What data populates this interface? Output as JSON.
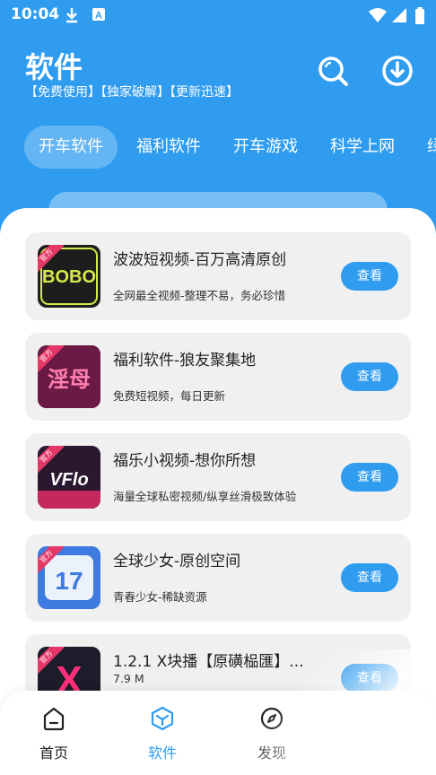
{
  "status_bar": {
    "time": "10:04",
    "icons": [
      "download-icon",
      "a-badge-icon",
      "wifi-icon",
      "signal-icon",
      "battery-icon"
    ]
  },
  "header": {
    "title": "软件",
    "subtitle": "【免费使用】【独家破解】【更新迅速】",
    "actions": [
      "search-icon",
      "download-icon"
    ]
  },
  "tabs": [
    {
      "label": "开车软件",
      "active": true
    },
    {
      "label": "福利软件",
      "active": false
    },
    {
      "label": "开车游戏",
      "active": false
    },
    {
      "label": "科学上网",
      "active": false
    },
    {
      "label": "绿",
      "active": false
    }
  ],
  "apps": [
    {
      "name": "波波短视频-百万高清原创",
      "desc": "全网最全视频-整理不易，务必珍惜",
      "button": "查看",
      "thumb_text": "BOBO",
      "thumb_bg": "#1d1d1d",
      "thumb_fg": "#d6e84a"
    },
    {
      "name": "福利软件-狼友聚集地",
      "desc": "免费短视频，每日更新",
      "button": "查看",
      "thumb_text": "淫母",
      "thumb_bg": "#6a1a44",
      "thumb_fg": "#ff7fb0"
    },
    {
      "name": "福乐小视频-想你所想",
      "desc": "海量全球私密视频/纵享丝滑极致体验",
      "button": "查看",
      "thumb_text": "VFlo",
      "thumb_bg": "#2a1830",
      "thumb_fg": "#ffffff"
    },
    {
      "name": "全球少女-原创空间",
      "desc": "青春少女-稀缺资源",
      "button": "查看",
      "thumb_text": "17",
      "thumb_bg": "#3d7be0",
      "thumb_fg": "#ffffff"
    },
    {
      "name": "1.2.1 X块播【原磺榀匯】...",
      "meta": "7.9 M",
      "button": "查看",
      "thumb_text": "X",
      "thumb_bg": "#1c1c2a",
      "thumb_fg": "#ff2f7a"
    }
  ],
  "ribbon_text": "官方",
  "bottom_nav": [
    {
      "label": "首页",
      "icon": "home-icon",
      "active": false
    },
    {
      "label": "软件",
      "icon": "cube-icon",
      "active": true
    },
    {
      "label": "发现",
      "icon": "compass-icon",
      "active": false
    }
  ],
  "colors": {
    "accent": "#2f9cf0",
    "card_bg": "#f0f0f0",
    "ribbon": "#e53868"
  }
}
